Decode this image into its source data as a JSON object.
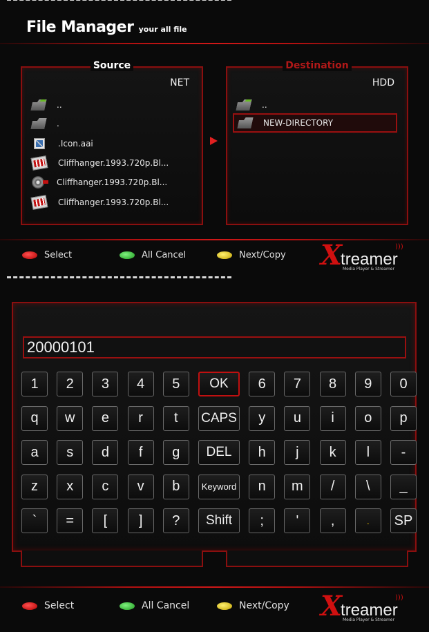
{
  "header": {
    "title": "File Manager",
    "subtitle": "your all file"
  },
  "source_panel": {
    "heading": "Source",
    "drive": "NET",
    "items": [
      {
        "icon": "folder-up-icon",
        "label": ".."
      },
      {
        "icon": "folder-icon",
        "label": "."
      },
      {
        "icon": "image-file-icon",
        "label": ".Icon.aai"
      },
      {
        "icon": "video-file-icon",
        "label": "Cliffhanger.1993.720p.Bl..."
      },
      {
        "icon": "film-reel-icon",
        "label": "Cliffhanger.1993.720p.Bl..."
      },
      {
        "icon": "video-file-icon",
        "label": "Cliffhanger.1993.720p.Bl..."
      }
    ]
  },
  "destination_panel": {
    "heading": "Destination",
    "drive": "HDD",
    "items": [
      {
        "icon": "folder-up-icon",
        "label": ".."
      },
      {
        "icon": "folder-icon",
        "label": "NEW-DIRECTORY"
      }
    ]
  },
  "hints": {
    "red": "Select",
    "green": "All Cancel",
    "yellow": "Next/Copy"
  },
  "logo": {
    "letter": "X",
    "word": "treamer",
    "tagline": "Media Player & Streamer"
  },
  "keyboard": {
    "input_value": "20000101",
    "rows": [
      [
        "1",
        "2",
        "3",
        "4",
        "5",
        "OK",
        "6",
        "7",
        "8",
        "9",
        "0"
      ],
      [
        "q",
        "w",
        "e",
        "r",
        "t",
        "CAPS",
        "y",
        "u",
        "i",
        "o",
        "p"
      ],
      [
        "a",
        "s",
        "d",
        "f",
        "g",
        "DEL",
        "h",
        "j",
        "k",
        "l",
        "-"
      ],
      [
        "z",
        "x",
        "c",
        "v",
        "b",
        "Keyword",
        "n",
        "m",
        "/",
        "\\",
        "_"
      ],
      [
        "`",
        "=",
        "[",
        "]",
        "?",
        "Shift",
        ";",
        "'",
        ",",
        ".",
        "SP"
      ]
    ]
  },
  "colors": {
    "accent": "#c01010",
    "background": "#0a0a0a",
    "border": "#8a0f0f"
  }
}
